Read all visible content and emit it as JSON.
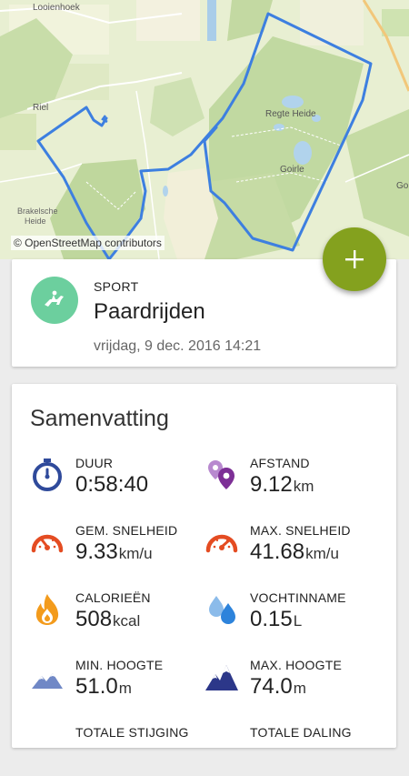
{
  "map": {
    "labels": {
      "looienhoek": "Looienhoek",
      "riel": "Riel",
      "regte_heide": "Regte Heide",
      "goirle": "Goirle",
      "goi": "Goi",
      "brakelsche_heide_1": "Brakelsche",
      "brakelsche_heide_2": "Heide"
    },
    "attribution": "© OpenStreetMap contributors",
    "route_color": "#3d7fe0"
  },
  "fab": {
    "icon": "plus-icon"
  },
  "sport": {
    "label": "SPORT",
    "name": "Paardrijden",
    "datetime": "vrijdag, 9 dec. 2016 14:21",
    "icon": "horse-rider-icon",
    "color": "#6ccf9e"
  },
  "summary": {
    "title": "Samenvatting",
    "stats": [
      {
        "label": "DUUR",
        "value": "0:58:40",
        "unit": "",
        "icon": "stopwatch-icon"
      },
      {
        "label": "AFSTAND",
        "value": "9.12",
        "unit": "km",
        "icon": "map-pins-icon"
      },
      {
        "label": "GEM. SNELHEID",
        "value": "9.33",
        "unit": "km/u",
        "icon": "speedometer-icon"
      },
      {
        "label": "MAX. SNELHEID",
        "value": "41.68",
        "unit": "km/u",
        "icon": "speedometer-max-icon"
      },
      {
        "label": "CALORIEËN",
        "value": "508",
        "unit": "kcal",
        "icon": "flame-icon"
      },
      {
        "label": "VOCHTINNAME",
        "value": "0.15",
        "unit": "L",
        "icon": "water-drops-icon"
      },
      {
        "label": "MIN. HOOGTE",
        "value": "51.0",
        "unit": "m",
        "icon": "mountain-min-icon"
      },
      {
        "label": "MAX. HOOGTE",
        "value": "74.0",
        "unit": "m",
        "icon": "mountain-max-icon"
      },
      {
        "label": "TOTALE STIJGING",
        "value": "",
        "unit": "",
        "icon": ""
      },
      {
        "label": "TOTALE DALING",
        "value": "",
        "unit": "",
        "icon": ""
      }
    ]
  }
}
